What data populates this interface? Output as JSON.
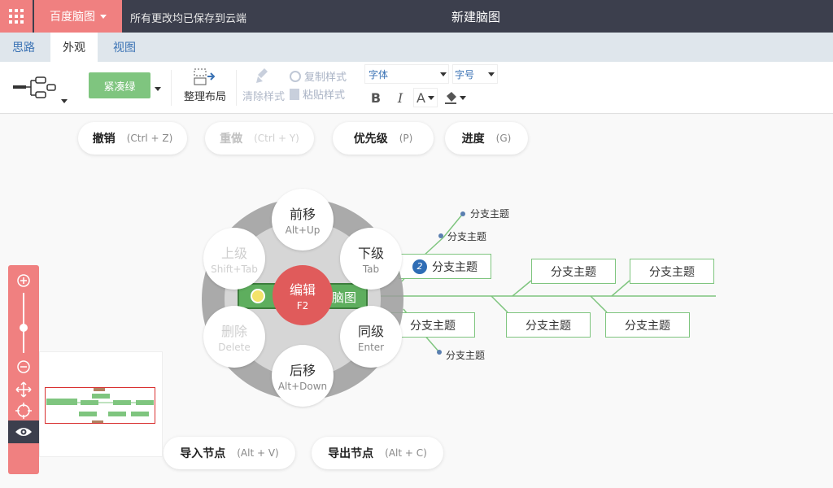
{
  "app": {
    "brand": "百度脑图",
    "save_status": "所有更改均已保存到云端",
    "doc_title": "新建脑图"
  },
  "tabs": [
    {
      "label": "思路",
      "active": false
    },
    {
      "label": "外观",
      "active": true
    },
    {
      "label": "视图",
      "active": false
    }
  ],
  "toolbar": {
    "theme": "紧凑绿",
    "arrange": "整理布局",
    "clear_style": "清除样式",
    "copy_style": "复制样式",
    "paste_style": "粘贴样式",
    "font": "字体",
    "size": "字号",
    "bold": "B",
    "italic": "I",
    "font_color": "A",
    "colors": {
      "theme": "#7fc57f",
      "brand": "#f08080"
    }
  },
  "actions": {
    "undo": {
      "label": "撤销",
      "shortcut": "(Ctrl + Z)"
    },
    "redo": {
      "label": "重做",
      "shortcut": "(Ctrl + Y)"
    },
    "priority": {
      "label": "优先级",
      "shortcut": "(P)"
    },
    "progress": {
      "label": "进度",
      "shortcut": "(G)"
    },
    "import": {
      "label": "导入节点",
      "shortcut": "(Alt + V)"
    },
    "export": {
      "label": "导出节点",
      "shortcut": "(Alt + C)"
    }
  },
  "wheel": {
    "forward": {
      "label": "前移",
      "shortcut": "Alt+Up"
    },
    "child": {
      "label": "下级",
      "shortcut": "Tab"
    },
    "sibling": {
      "label": "同级",
      "shortcut": "Enter"
    },
    "backward": {
      "label": "后移",
      "shortcut": "Alt+Down"
    },
    "delete": {
      "label": "删除",
      "shortcut": "Delete"
    },
    "parent": {
      "label": "上级",
      "shortcut": "Shift+Tab"
    },
    "edit": {
      "label": "编辑",
      "shortcut": "F2"
    }
  },
  "mindmap": {
    "root": "脑图",
    "topic_label": "分支主题",
    "priority_badge": "2"
  }
}
